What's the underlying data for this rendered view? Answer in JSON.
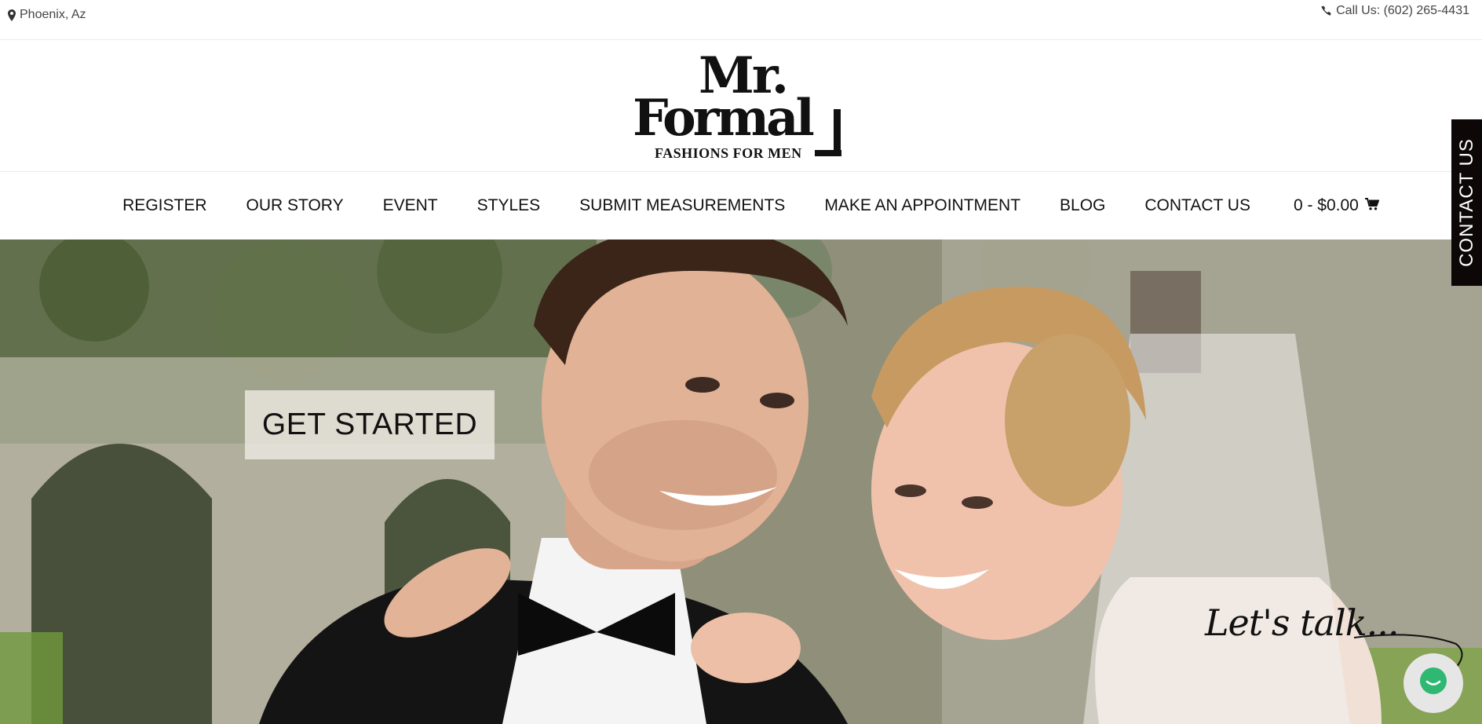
{
  "topbar": {
    "location": "Phoenix, Az",
    "location_icon": "map-marker-icon",
    "phone": "Call Us: (602) 265-4431",
    "phone_icon": "phone-icon"
  },
  "logo": {
    "line1": "Mr.",
    "line2": "Formal",
    "tagline": "FASHIONS FOR MEN"
  },
  "nav": {
    "items": [
      "REGISTER",
      "OUR STORY",
      "EVENT",
      "STYLES",
      "SUBMIT MEASUREMENTS",
      "MAKE AN APPOINTMENT",
      "BLOG",
      "CONTACT US"
    ],
    "cart_label": "0 - $0.00",
    "cart_icon": "shopping-cart-icon"
  },
  "hero": {
    "cta": "GET STARTED"
  },
  "side_tab": {
    "label": "CONTACT US",
    "background": "#0d0707"
  },
  "chat": {
    "prompt": "Let's talk...",
    "icon": "chat-bubble-icon",
    "accent": "#2eb872"
  }
}
